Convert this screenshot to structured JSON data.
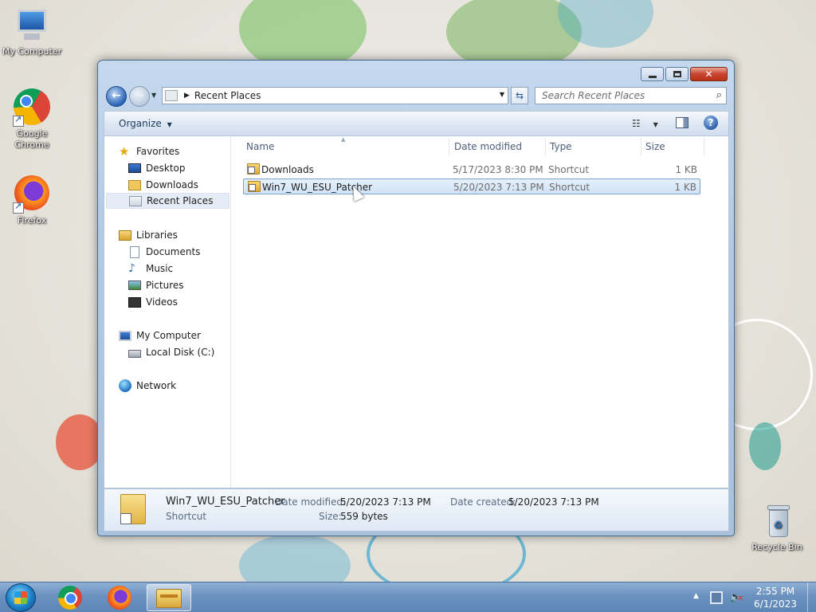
{
  "desktop": {
    "icons": [
      {
        "label": "My Computer"
      },
      {
        "label": "Google Chrome"
      },
      {
        "label": "Firefox"
      },
      {
        "label": "Recycle Bin"
      }
    ]
  },
  "window": {
    "address": {
      "crumb": "Recent Places"
    },
    "search": {
      "placeholder": "Search Recent Places"
    },
    "toolbar": {
      "organize": "Organize"
    },
    "nav": {
      "favorites": "Favorites",
      "desktop": "Desktop",
      "downloads": "Downloads",
      "recent_places": "Recent Places",
      "libraries": "Libraries",
      "documents": "Documents",
      "music": "Music",
      "pictures": "Pictures",
      "videos": "Videos",
      "my_computer": "My Computer",
      "local_disk": "Local Disk (C:)",
      "network": "Network"
    },
    "columns": {
      "name": "Name",
      "date": "Date modified",
      "type": "Type",
      "size": "Size"
    },
    "files": [
      {
        "name": "Downloads",
        "date": "5/17/2023 8:30 PM",
        "type": "Shortcut",
        "size": "1 KB"
      },
      {
        "name": "Win7_WU_ESU_Patcher",
        "date": "5/20/2023 7:13 PM",
        "type": "Shortcut",
        "size": "1 KB"
      }
    ],
    "details": {
      "name": "Win7_WU_ESU_Patcher",
      "kind": "Shortcut",
      "date_modified_label": "Date modified:",
      "date_modified": "5/20/2023 7:13 PM",
      "date_created_label": "Date created:",
      "date_created": "5/20/2023 7:13 PM",
      "size_label": "Size:",
      "size": "559 bytes"
    }
  },
  "taskbar": {
    "clock": {
      "time": "2:55 PM",
      "date": "6/1/2023"
    }
  },
  "icons": {
    "start": "windows-flag-icon",
    "back": "back-arrow-icon",
    "forward": "forward-arrow-icon",
    "search": "magnifier-icon",
    "help": "question-icon"
  },
  "colors": {
    "accent": "#2a63b8",
    "selection": "#cfe3f7",
    "taskbar": "#6a91bf"
  }
}
